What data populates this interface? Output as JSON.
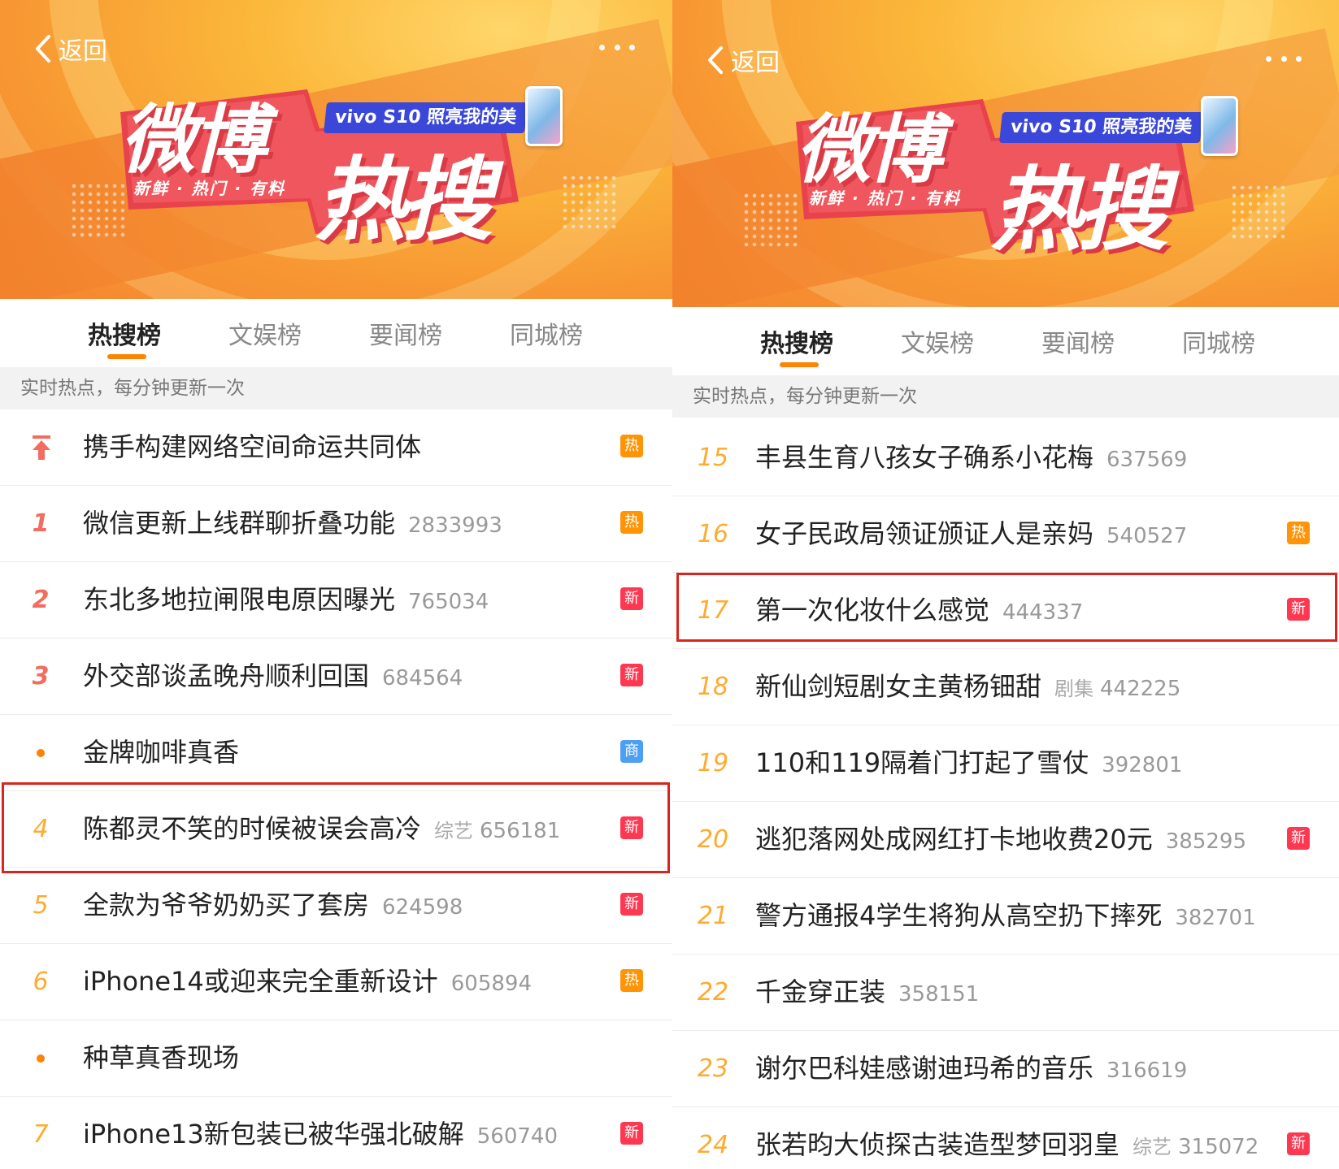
{
  "left": {
    "back_label": "返回",
    "banner": {
      "title": "微博",
      "hot": "热搜",
      "sub": "新鲜 · 热门 · 有料",
      "promo": "vivo S10 照亮我的美"
    },
    "tabs": [
      {
        "label": "热搜榜",
        "active": true
      },
      {
        "label": "文娱榜",
        "active": false
      },
      {
        "label": "要闻榜",
        "active": false
      },
      {
        "label": "同城榜",
        "active": false
      }
    ],
    "notice": "实时热点，每分钟更新一次",
    "rows": [
      {
        "rank": "",
        "marker": "pin",
        "title": "携手构建网络空间命运共同体",
        "category": "",
        "heat": "",
        "badge": "热",
        "badge_type": "hot"
      },
      {
        "rank": "1",
        "title": "微信更新上线群聊折叠功能",
        "category": "",
        "heat": "2833993",
        "badge": "热",
        "badge_type": "hot"
      },
      {
        "rank": "2",
        "title": "东北多地拉闸限电原因曝光",
        "category": "",
        "heat": "765034",
        "badge": "新",
        "badge_type": "new"
      },
      {
        "rank": "3",
        "title": "外交部谈孟晚舟顺利回国",
        "category": "",
        "heat": "684564",
        "badge": "新",
        "badge_type": "new"
      },
      {
        "rank": "",
        "marker": "dot",
        "title": "金牌咖啡真香",
        "category": "",
        "heat": "",
        "badge": "商",
        "badge_type": "biz"
      },
      {
        "rank": "4",
        "title": "陈都灵不笑的时候被误会高冷",
        "category": "综艺",
        "heat": "656181",
        "badge": "新",
        "badge_type": "new",
        "highlight": true
      },
      {
        "rank": "5",
        "title": "全款为爷爷奶奶买了套房",
        "category": "",
        "heat": "624598",
        "badge": "新",
        "badge_type": "new"
      },
      {
        "rank": "6",
        "title": "iPhone14或迎来完全重新设计",
        "category": "",
        "heat": "605894",
        "badge": "热",
        "badge_type": "hot"
      },
      {
        "rank": "",
        "marker": "dot",
        "title": "种草真香现场",
        "category": "",
        "heat": "",
        "badge": "",
        "badge_type": ""
      },
      {
        "rank": "7",
        "title": "iPhone13新包装已被华强北破解",
        "category": "",
        "heat": "560740",
        "badge": "新",
        "badge_type": "new"
      }
    ]
  },
  "right": {
    "back_label": "返回",
    "banner": {
      "title": "微博",
      "hot": "热搜",
      "sub": "新鲜 · 热门 · 有料",
      "promo": "vivo S10 照亮我的美"
    },
    "tabs": [
      {
        "label": "热搜榜",
        "active": true
      },
      {
        "label": "文娱榜",
        "active": false
      },
      {
        "label": "要闻榜",
        "active": false
      },
      {
        "label": "同城榜",
        "active": false
      }
    ],
    "notice": "实时热点，每分钟更新一次",
    "rows": [
      {
        "rank": "15",
        "title": "丰县生育八孩女子确系小花梅",
        "category": "",
        "heat": "637569",
        "badge": "",
        "badge_type": ""
      },
      {
        "rank": "16",
        "title": "女子民政局领证颁证人是亲妈",
        "category": "",
        "heat": "540527",
        "badge": "热",
        "badge_type": "hot"
      },
      {
        "rank": "17",
        "title": "第一次化妆什么感觉",
        "category": "",
        "heat": "444337",
        "badge": "新",
        "badge_type": "new",
        "highlight": true
      },
      {
        "rank": "18",
        "title": "新仙剑短剧女主黄杨钿甜",
        "category": "剧集",
        "heat": "442225",
        "badge": "",
        "badge_type": ""
      },
      {
        "rank": "19",
        "title": "110和119隔着门打起了雪仗",
        "category": "",
        "heat": "392801",
        "badge": "",
        "badge_type": ""
      },
      {
        "rank": "20",
        "title": "逃犯落网处成网红打卡地收费20元",
        "category": "",
        "heat": "385295",
        "badge": "新",
        "badge_type": "new"
      },
      {
        "rank": "21",
        "title": "警方通报4学生将狗从高空扔下摔死",
        "category": "",
        "heat": "382701",
        "badge": "",
        "badge_type": ""
      },
      {
        "rank": "22",
        "title": "千金穿正装",
        "category": "",
        "heat": "358151",
        "badge": "",
        "badge_type": ""
      },
      {
        "rank": "23",
        "title": "谢尔巴科娃感谢迪玛希的音乐",
        "category": "",
        "heat": "316619",
        "badge": "",
        "badge_type": ""
      },
      {
        "rank": "24",
        "title": "张若昀大侦探古装造型梦回羽皇",
        "category": "综艺",
        "heat": "315072",
        "badge": "新",
        "badge_type": "new"
      }
    ]
  },
  "colors": {
    "accent": "#ff8200",
    "rank_top3": "#f26d5f",
    "rank_other": "#ffab2d",
    "badge_hot": "#ff9406",
    "badge_new": "#ff3852",
    "badge_biz": "#4d9ff5",
    "highlight_box": "#d9251d"
  },
  "icons": {
    "back": "chevron-left-icon",
    "more": "more-dots-icon",
    "pin": "pin-top-icon",
    "dot": "dot-icon"
  }
}
